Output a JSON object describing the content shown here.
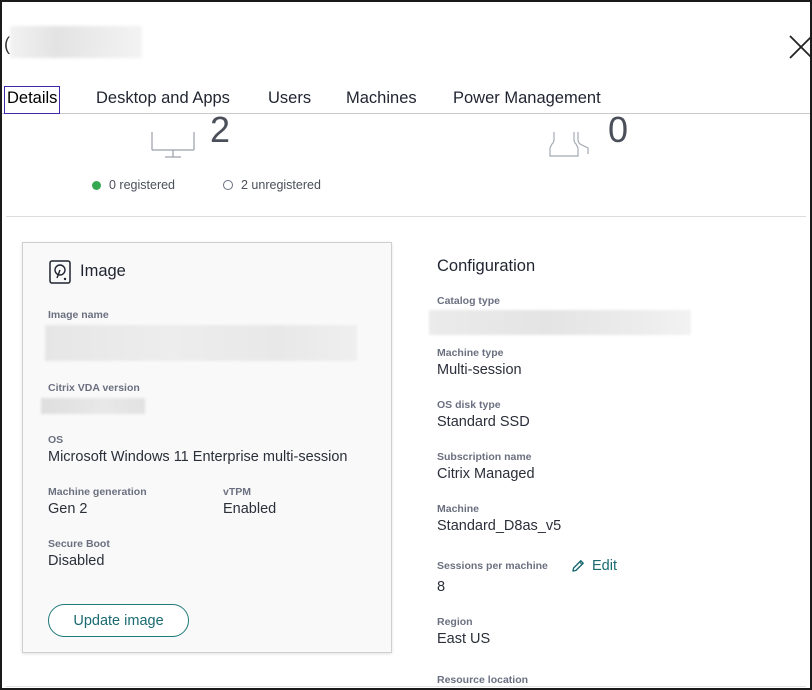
{
  "header": {
    "title_visible_char": "("
  },
  "tabs": [
    {
      "label": "Details",
      "active": true
    },
    {
      "label": "Desktop and Apps",
      "active": false
    },
    {
      "label": "Users",
      "active": false
    },
    {
      "label": "Machines",
      "active": false
    },
    {
      "label": "Power Management",
      "active": false
    }
  ],
  "summary": {
    "machines_count": "2",
    "sessions_count": "0",
    "registered": "0 registered",
    "unregistered": "2 unregistered"
  },
  "image_card": {
    "title": "Image",
    "fields": {
      "image_name_label": "Image name",
      "vda_label": "Citrix VDA version",
      "os_label": "OS",
      "os_value": "Microsoft Windows 11 Enterprise multi-session",
      "generation_label": "Machine generation",
      "generation_value": "Gen 2",
      "vtpm_label": "vTPM",
      "vtpm_value": "Enabled",
      "secure_boot_label": "Secure Boot",
      "secure_boot_value": "Disabled"
    },
    "update_button": "Update image"
  },
  "configuration": {
    "title": "Configuration",
    "catalog_type_label": "Catalog type",
    "machine_type_label": "Machine type",
    "machine_type_value": "Multi-session",
    "os_disk_label": "OS disk type",
    "os_disk_value": "Standard SSD",
    "subscription_label": "Subscription name",
    "subscription_value": "Citrix Managed",
    "machine_label": "Machine",
    "machine_value": "Standard_D8as_v5",
    "sessions_label": "Sessions per machine",
    "sessions_value": "8",
    "edit_label": "Edit",
    "region_label": "Region",
    "region_value": "East US",
    "resource_location_label": "Resource location"
  },
  "colors": {
    "accent": "#1a6a70",
    "active_tab_border": "#3b2ba8",
    "registered_dot": "#35a852"
  }
}
